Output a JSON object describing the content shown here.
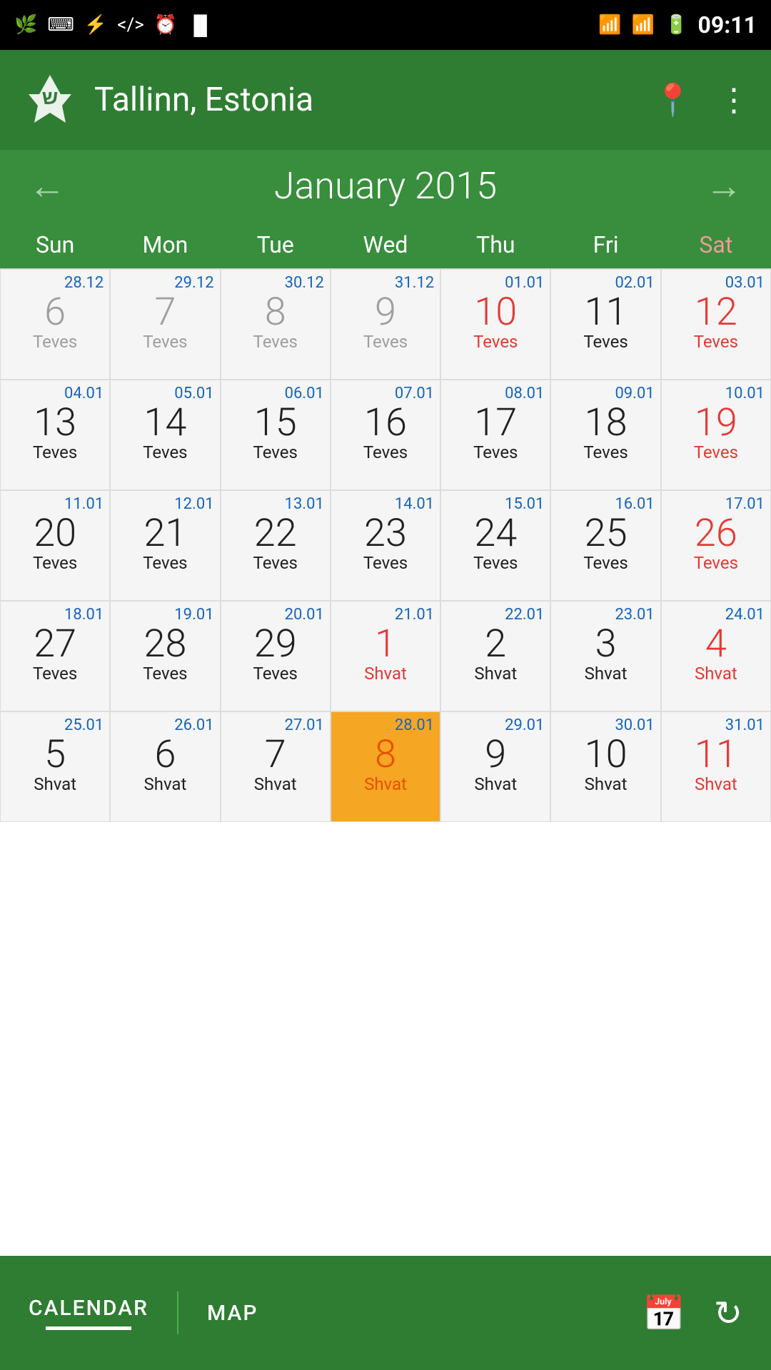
{
  "statusBar": {
    "time": "09:11",
    "leftIcons": [
      "feather-icon",
      "code-icon",
      "usb-icon",
      "brackets-icon",
      "clock-icon",
      "barcode-icon"
    ],
    "rightIcons": [
      "wifi-icon",
      "signal-icon",
      "battery-icon"
    ]
  },
  "header": {
    "logoAlt": "Jewish Calendar App Logo",
    "title": "Tallinn, Estonia",
    "locationIconLabel": "location-icon",
    "menuIconLabel": "more-options-icon"
  },
  "monthNav": {
    "prevLabel": "←",
    "nextLabel": "→",
    "title": "January 2015"
  },
  "dayHeaders": [
    {
      "label": "Sun",
      "type": "normal"
    },
    {
      "label": "Mon",
      "type": "normal"
    },
    {
      "label": "Tue",
      "type": "normal"
    },
    {
      "label": "Wed",
      "type": "normal"
    },
    {
      "label": "Thu",
      "type": "normal"
    },
    {
      "label": "Fri",
      "type": "normal"
    },
    {
      "label": "Sat",
      "type": "sat"
    }
  ],
  "weeks": [
    {
      "cells": [
        {
          "dateSmall": "28.12",
          "dayNum": "6",
          "dayColor": "gray",
          "hebrew": "Teves",
          "hebColor": "gray",
          "today": false
        },
        {
          "dateSmall": "29.12",
          "dayNum": "7",
          "dayColor": "gray",
          "hebrew": "Teves",
          "hebColor": "gray",
          "today": false
        },
        {
          "dateSmall": "30.12",
          "dayNum": "8",
          "dayColor": "gray",
          "hebrew": "Teves",
          "hebColor": "gray",
          "today": false
        },
        {
          "dateSmall": "31.12",
          "dayNum": "9",
          "dayColor": "gray",
          "hebrew": "Teves",
          "hebColor": "gray",
          "today": false
        },
        {
          "dateSmall": "01.01",
          "dayNum": "10",
          "dayColor": "red",
          "hebrew": "Teves",
          "hebColor": "red",
          "today": false
        },
        {
          "dateSmall": "02.01",
          "dayNum": "11",
          "dayColor": "normal",
          "hebrew": "Teves",
          "hebColor": "normal",
          "today": false
        },
        {
          "dateSmall": "03.01",
          "dayNum": "12",
          "dayColor": "red",
          "hebrew": "Teves",
          "hebColor": "red",
          "today": false
        }
      ]
    },
    {
      "cells": [
        {
          "dateSmall": "04.01",
          "dayNum": "13",
          "dayColor": "normal",
          "hebrew": "Teves",
          "hebColor": "normal",
          "today": false
        },
        {
          "dateSmall": "05.01",
          "dayNum": "14",
          "dayColor": "normal",
          "hebrew": "Teves",
          "hebColor": "normal",
          "today": false
        },
        {
          "dateSmall": "06.01",
          "dayNum": "15",
          "dayColor": "normal",
          "hebrew": "Teves",
          "hebColor": "normal",
          "today": false
        },
        {
          "dateSmall": "07.01",
          "dayNum": "16",
          "dayColor": "normal",
          "hebrew": "Teves",
          "hebColor": "normal",
          "today": false
        },
        {
          "dateSmall": "08.01",
          "dayNum": "17",
          "dayColor": "normal",
          "hebrew": "Teves",
          "hebColor": "normal",
          "today": false
        },
        {
          "dateSmall": "09.01",
          "dayNum": "18",
          "dayColor": "normal",
          "hebrew": "Teves",
          "hebColor": "normal",
          "today": false
        },
        {
          "dateSmall": "10.01",
          "dayNum": "19",
          "dayColor": "red",
          "hebrew": "Teves",
          "hebColor": "red",
          "today": false
        }
      ]
    },
    {
      "cells": [
        {
          "dateSmall": "11.01",
          "dayNum": "20",
          "dayColor": "normal",
          "hebrew": "Teves",
          "hebColor": "normal",
          "today": false
        },
        {
          "dateSmall": "12.01",
          "dayNum": "21",
          "dayColor": "normal",
          "hebrew": "Teves",
          "hebColor": "normal",
          "today": false
        },
        {
          "dateSmall": "13.01",
          "dayNum": "22",
          "dayColor": "normal",
          "hebrew": "Teves",
          "hebColor": "normal",
          "today": false
        },
        {
          "dateSmall": "14.01",
          "dayNum": "23",
          "dayColor": "normal",
          "hebrew": "Teves",
          "hebColor": "normal",
          "today": false
        },
        {
          "dateSmall": "15.01",
          "dayNum": "24",
          "dayColor": "normal",
          "hebrew": "Teves",
          "hebColor": "normal",
          "today": false
        },
        {
          "dateSmall": "16.01",
          "dayNum": "25",
          "dayColor": "normal",
          "hebrew": "Teves",
          "hebColor": "normal",
          "today": false
        },
        {
          "dateSmall": "17.01",
          "dayNum": "26",
          "dayColor": "red",
          "hebrew": "Teves",
          "hebColor": "red",
          "today": false
        }
      ]
    },
    {
      "cells": [
        {
          "dateSmall": "18.01",
          "dayNum": "27",
          "dayColor": "normal",
          "hebrew": "Teves",
          "hebColor": "normal",
          "today": false
        },
        {
          "dateSmall": "19.01",
          "dayNum": "28",
          "dayColor": "normal",
          "hebrew": "Teves",
          "hebColor": "normal",
          "today": false
        },
        {
          "dateSmall": "20.01",
          "dayNum": "29",
          "dayColor": "normal",
          "hebrew": "Teves",
          "hebColor": "normal",
          "today": false
        },
        {
          "dateSmall": "21.01",
          "dayNum": "1",
          "dayColor": "red",
          "hebrew": "Shvat",
          "hebColor": "red",
          "today": false
        },
        {
          "dateSmall": "22.01",
          "dayNum": "2",
          "dayColor": "normal",
          "hebrew": "Shvat",
          "hebColor": "normal",
          "today": false
        },
        {
          "dateSmall": "23.01",
          "dayNum": "3",
          "dayColor": "normal",
          "hebrew": "Shvat",
          "hebColor": "normal",
          "today": false
        },
        {
          "dateSmall": "24.01",
          "dayNum": "4",
          "dayColor": "red",
          "hebrew": "Shvat",
          "hebColor": "red",
          "today": false
        }
      ]
    },
    {
      "cells": [
        {
          "dateSmall": "25.01",
          "dayNum": "5",
          "dayColor": "normal",
          "hebrew": "Shvat",
          "hebColor": "normal",
          "today": false
        },
        {
          "dateSmall": "26.01",
          "dayNum": "6",
          "dayColor": "normal",
          "hebrew": "Shvat",
          "hebColor": "normal",
          "today": false
        },
        {
          "dateSmall": "27.01",
          "dayNum": "7",
          "dayColor": "normal",
          "hebrew": "Shvat",
          "hebColor": "normal",
          "today": false
        },
        {
          "dateSmall": "28.01",
          "dayNum": "8",
          "dayColor": "today",
          "hebrew": "Shvat",
          "hebColor": "today",
          "today": true
        },
        {
          "dateSmall": "29.01",
          "dayNum": "9",
          "dayColor": "normal",
          "hebrew": "Shvat",
          "hebColor": "normal",
          "today": false
        },
        {
          "dateSmall": "30.01",
          "dayNum": "10",
          "dayColor": "normal",
          "hebrew": "Shvat",
          "hebColor": "normal",
          "today": false
        },
        {
          "dateSmall": "31.01",
          "dayNum": "11",
          "dayColor": "red",
          "hebrew": "Shvat",
          "hebColor": "red",
          "today": false
        }
      ]
    }
  ],
  "bottomBar": {
    "tabs": [
      {
        "label": "CALENDAR",
        "active": true
      },
      {
        "label": "MAP",
        "active": false
      }
    ],
    "actions": [
      {
        "icon": "calendar-today-icon"
      },
      {
        "icon": "refresh-icon"
      }
    ]
  }
}
